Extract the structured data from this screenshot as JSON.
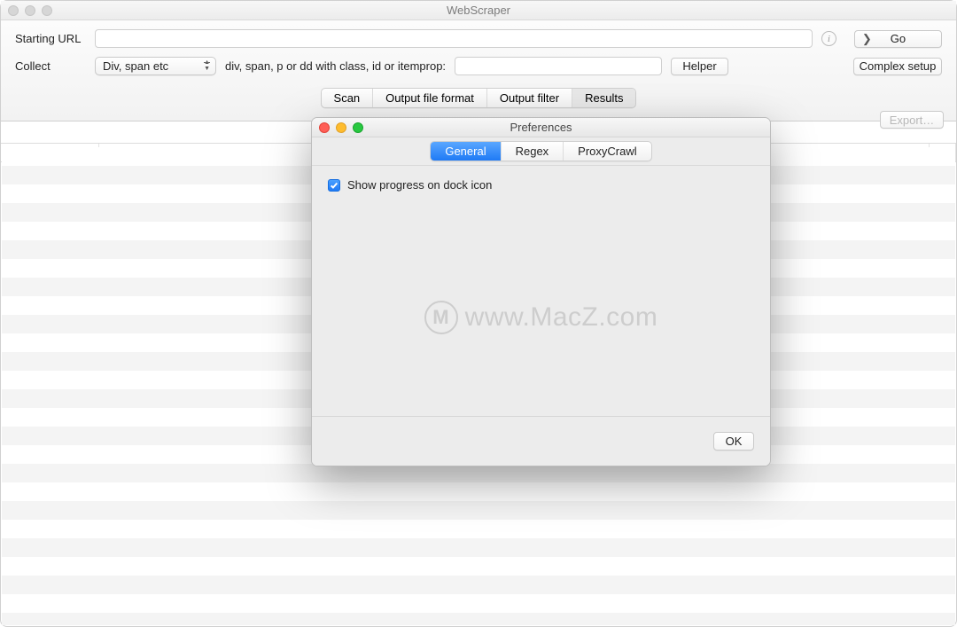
{
  "window": {
    "title": "WebScraper"
  },
  "toolbar": {
    "starting_url_label": "Starting URL",
    "url_value": "",
    "go_label": "Go",
    "collect_label": "Collect",
    "select_value": "Div, span etc",
    "hint": "div, span, p or dd with class, id or itemprop:",
    "collect_value": "",
    "helper_label": "Helper",
    "complex_label": "Complex setup"
  },
  "segments": {
    "scan": "Scan",
    "output_format": "Output file format",
    "output_filter": "Output filter",
    "results": "Results"
  },
  "export_label": "Export…",
  "prefs": {
    "title": "Preferences",
    "tabs": {
      "general": "General",
      "regex": "Regex",
      "proxy": "ProxyCrawl"
    },
    "checkbox_label": "Show progress on dock icon",
    "ok_label": "OK",
    "watermark": "www.MacZ.com"
  }
}
